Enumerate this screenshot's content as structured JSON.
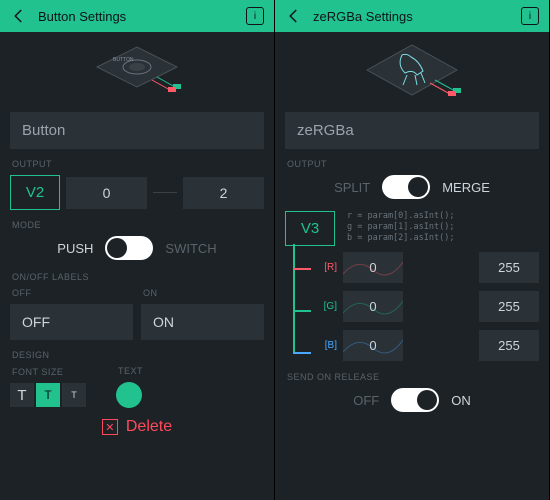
{
  "left": {
    "header": {
      "title": "Button Settings"
    },
    "name": "Button",
    "labels": {
      "output": "OUTPUT",
      "mode": "MODE",
      "onoff": "ON/OFF LABELS",
      "off": "OFF",
      "on": "ON",
      "design": "DESIGN",
      "font_size": "FONT SIZE",
      "text": "TEXT"
    },
    "output": {
      "pin": "V2",
      "min": "0",
      "max": "2"
    },
    "mode": {
      "left": "PUSH",
      "right": "SWITCH"
    },
    "onoff": {
      "off_value": "OFF",
      "on_value": "ON"
    },
    "font_sizes": [
      "T",
      "T",
      "T"
    ],
    "delete": "Delete"
  },
  "right": {
    "header": {
      "title": "zeRGBa Settings"
    },
    "name": "zeRGBa",
    "labels": {
      "output": "OUTPUT",
      "send": "SEND ON RELEASE"
    },
    "mode": {
      "left": "SPLIT",
      "right": "MERGE"
    },
    "pin": "V3",
    "code": {
      "r": "r = param[0].asInt();",
      "g": "g = param[1].asInt();",
      "b": "b = param[2].asInt();"
    },
    "channels": [
      {
        "name": "[R]",
        "min": "0",
        "max": "255",
        "color": "#ff5a6a"
      },
      {
        "name": "[G]",
        "min": "0",
        "max": "255",
        "color": "#21c28e"
      },
      {
        "name": "[B]",
        "min": "0",
        "max": "255",
        "color": "#4aa8ff"
      }
    ],
    "send": {
      "off": "OFF",
      "on": "ON"
    }
  }
}
